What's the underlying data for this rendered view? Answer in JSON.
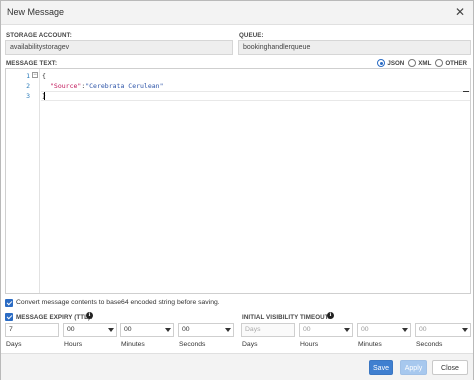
{
  "dialog": {
    "title": "New Message"
  },
  "storage_account": {
    "label": "STORAGE ACCOUNT:",
    "value": "availabilitystoragev"
  },
  "queue": {
    "label": "QUEUE:",
    "value": "bookinghandlerqueue"
  },
  "message_text": {
    "label": "MESSAGE TEXT:",
    "formats": [
      {
        "label": "JSON",
        "selected": true
      },
      {
        "label": "XML",
        "selected": false
      },
      {
        "label": "OTHER",
        "selected": false
      }
    ]
  },
  "editor": {
    "line_numbers": [
      "1",
      "2",
      "3"
    ],
    "lines": {
      "l1": "{",
      "l2_key": "\"Source\"",
      "l2_colon": ":",
      "l2_value": "\"Cerebrata Cerulean\"",
      "l3": "}"
    },
    "fold_symbol": "−"
  },
  "base64_option": {
    "checked": true,
    "label": "Convert message contents to base64 encoded string before saving."
  },
  "expiry": {
    "checked": true,
    "label": "MESSAGE EXPIRY (TTL):",
    "days_value": "7",
    "hours": "00",
    "minutes": "00",
    "seconds": "00",
    "units": {
      "days": "Days",
      "hours": "Hours",
      "minutes": "Minutes",
      "seconds": "Seconds"
    }
  },
  "visibility": {
    "label": "INITIAL VISIBILITY TIMEOUT:",
    "days_placeholder": "Days",
    "hours": "00",
    "minutes": "00",
    "seconds": "00",
    "units": {
      "days": "Days",
      "hours": "Hours",
      "minutes": "Minutes",
      "seconds": "Seconds"
    }
  },
  "footer": {
    "save_label": "Save",
    "apply_label": "Apply",
    "close_label": "Close"
  },
  "icons": {
    "close": "close-icon",
    "info": "info-icon",
    "dropdown": "chevron-down-icon",
    "check": "check-icon"
  },
  "colors": {
    "accent": "#3f7fd0",
    "apply_disabled": "#a7c8ee",
    "json_key": "#c2185b",
    "json_value": "#2d54a8",
    "line_number": "#2b7bb9"
  }
}
